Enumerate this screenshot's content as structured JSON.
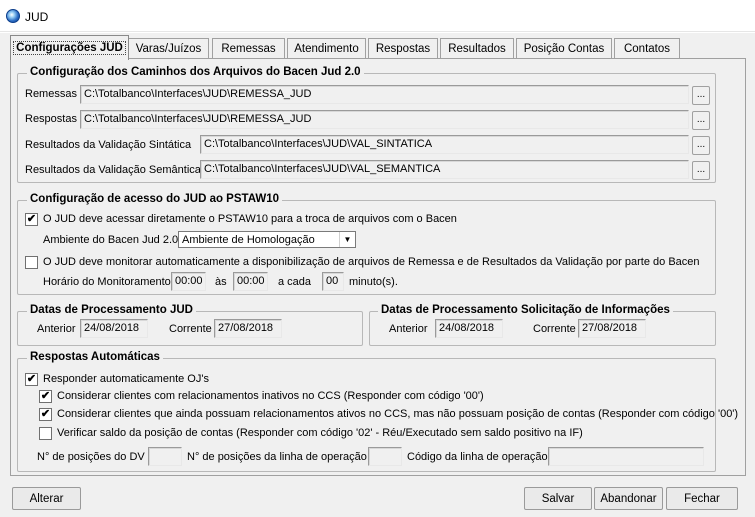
{
  "window": {
    "title": "JUD"
  },
  "tabs": [
    {
      "label": "Configurações JUD"
    },
    {
      "label": "Varas/Juízos"
    },
    {
      "label": "Remessas"
    },
    {
      "label": "Atendimento"
    },
    {
      "label": "Respostas"
    },
    {
      "label": "Resultados"
    },
    {
      "label": "Posição Contas"
    },
    {
      "label": "Contatos"
    }
  ],
  "paths": {
    "title": "Configuração dos Caminhos dos Arquivos do Bacen Jud 2.0",
    "remessas_label": "Remessas",
    "remessas_value": "C:\\Totalbanco\\Interfaces\\JUD\\REMESSA_JUD",
    "respostas_label": "Respostas",
    "respostas_value": "C:\\Totalbanco\\Interfaces\\JUD\\REMESSA_JUD",
    "sintatica_label": "Resultados da Validação Sintática",
    "sintatica_value": "C:\\Totalbanco\\Interfaces\\JUD\\VAL_SINTATICA",
    "semantica_label": "Resultados da Validação Semântica",
    "semantica_value": "C:\\Totalbanco\\Interfaces\\JUD\\VAL_SEMANTICA",
    "browse_label": "..."
  },
  "access": {
    "title": "Configuração de acesso do JUD ao PSTAW10",
    "direct_label": "O JUD deve acessar diretamente o PSTAW10 para a troca de arquivos com o Bacen",
    "direct_checked": true,
    "ambiente_label": "Ambiente do Bacen Jud 2.0",
    "ambiente_value": "Ambiente de Homologação",
    "monitor_label": "O JUD deve monitorar automaticamente a disponibilização de arquivos de Remessa e de Resultados da Validação por parte do Bacen",
    "monitor_checked": false,
    "horario_label": "Horário do Monitoramento",
    "start_time": "00:00",
    "as_label": "às",
    "end_time": "00:00",
    "cada_label": "a cada",
    "interval": "00",
    "minutos_label": "minuto(s)."
  },
  "dates_jud": {
    "title": "Datas de Processamento JUD",
    "anterior_label": "Anterior",
    "anterior_value": "24/08/2018",
    "corrente_label": "Corrente",
    "corrente_value": "27/08/2018"
  },
  "dates_info": {
    "title": "Datas de Processamento Solicitação de Informações",
    "anterior_label": "Anterior",
    "anterior_value": "24/08/2018",
    "corrente_label": "Corrente",
    "corrente_value": "27/08/2018"
  },
  "auto": {
    "title": "Respostas Automáticas",
    "responder_label": "Responder automaticamente OJ's",
    "responder_checked": true,
    "inativos_label": "Considerar clientes com relacionamentos inativos no CCS (Responder com código '00')",
    "inativos_checked": true,
    "ativos_label": "Considerar clientes que ainda possuam relacionamentos ativos no CCS, mas não possuam posição de contas (Responder com código '00')",
    "ativos_checked": true,
    "saldo_label": "Verificar saldo da posição de contas (Responder com código '02' - Réu/Executado sem saldo positivo na IF)",
    "saldo_checked": false,
    "dv_label": "N° de posições do DV",
    "dv_value": "",
    "linha_label": "N° de posições da linha de operação",
    "linha_value": "",
    "codigo_label": "Código da linha de operação",
    "codigo_value": ""
  },
  "buttons": {
    "alterar": "Alterar",
    "salvar": "Salvar",
    "abandonar": "Abandonar",
    "fechar": "Fechar"
  },
  "checkmark": "✔"
}
